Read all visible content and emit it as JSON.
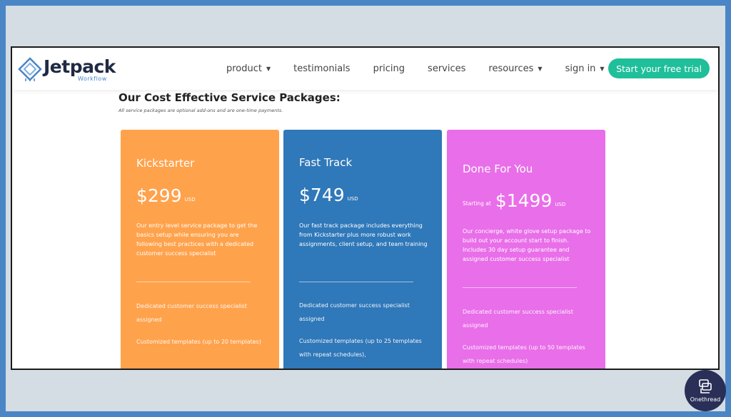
{
  "brand": {
    "name": "Jetpack",
    "sub": "Workflow",
    "colors": {
      "blue": "#4a86c5",
      "dark": "#1f2a44",
      "teal": "#1fbf9a"
    }
  },
  "nav": {
    "items": [
      {
        "label": "product",
        "dropdown": true
      },
      {
        "label": "testimonials",
        "dropdown": false
      },
      {
        "label": "pricing",
        "dropdown": false
      },
      {
        "label": "services",
        "dropdown": false
      },
      {
        "label": "resources",
        "dropdown": true
      },
      {
        "label": "sign in",
        "dropdown": true
      }
    ],
    "cta": "Start your free trial"
  },
  "section": {
    "title": "Our Cost Effective Service Packages:",
    "subtitle": "All service packages are optional add-ons and are one-time payments."
  },
  "cards": [
    {
      "name": "Kickstarter",
      "starting": "",
      "price": "$299",
      "currency": "USD",
      "color": "#ffa24c",
      "description": "Our entry level service package to get the basics setup while ensuring you are following best practices with a dedicated customer success specialist",
      "features": [
        "Dedicated customer success specialist assigned",
        "Customized templates (up to 20 templates)"
      ]
    },
    {
      "name": "Fast Track",
      "starting": "",
      "price": "$749",
      "currency": "USD",
      "color": "#2f78b9",
      "description": "Our fast track package includes everything from Kickstarter plus more robust work assignments, client setup, and team training",
      "features": [
        "Dedicated customer success specialist assigned",
        "Customized templates (up to 25 templates with repeat schedules),"
      ]
    },
    {
      "name": "Done For You",
      "starting": "Starting at",
      "price": "$1499",
      "currency": "USD",
      "color": "#e96ee9",
      "description": "Our concierge, white glove setup package to build out your account start to finish. Includes 30 day setup guarantee and assigned customer success specialist",
      "features": [
        "Dedicated customer success specialist assigned",
        "Customized templates (up to 50 templates with repeat schedules)"
      ]
    }
  ],
  "watermark": {
    "label": "Onethread"
  }
}
